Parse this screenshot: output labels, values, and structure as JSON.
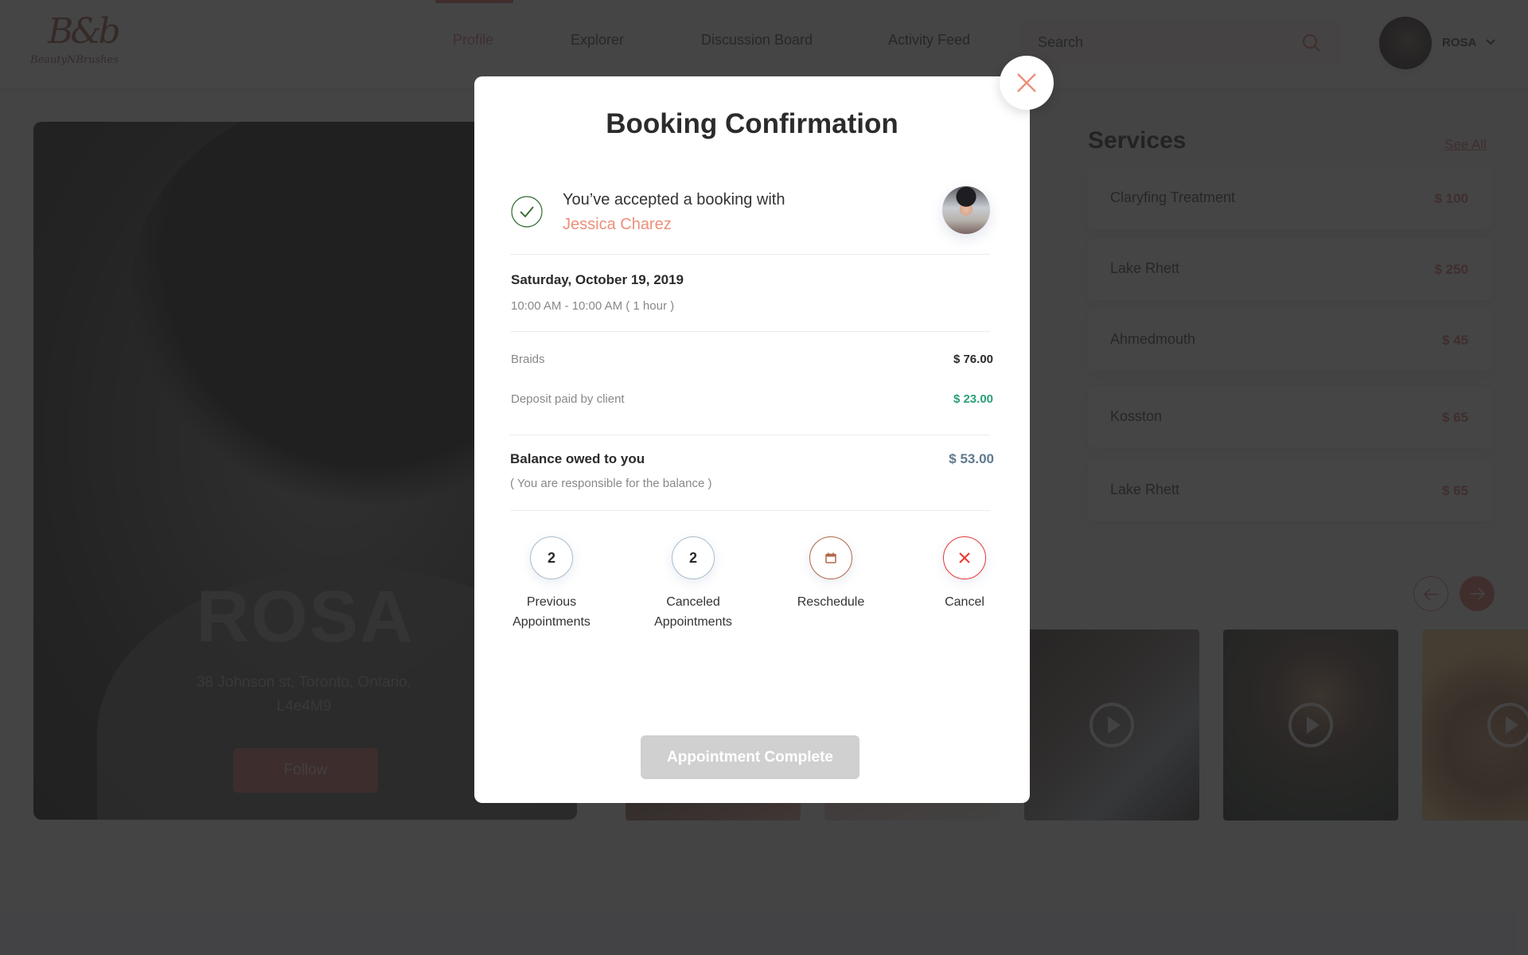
{
  "header": {
    "logo": {
      "monogram": "B&b",
      "wordmark": "BeautyNBrushes"
    },
    "nav": [
      {
        "label": "Profile",
        "active": true
      },
      {
        "label": "Explorer",
        "active": false
      },
      {
        "label": "Discussion Board",
        "active": false
      },
      {
        "label": "Activity Feed",
        "active": false
      }
    ],
    "search": {
      "placeholder": "Search",
      "value": ""
    },
    "user": {
      "name": "ROSA"
    }
  },
  "profile": {
    "name": "ROSA",
    "address": "38 Johnson st, Toronto, Ontario, L4e4M9",
    "follow_label": "Follow"
  },
  "services": {
    "title": "Services",
    "see_all_label": "See All",
    "items": [
      {
        "name": "Claryfing Treatment",
        "price": "$ 100"
      },
      {
        "name": "Lake Rhett",
        "price": "$ 250"
      },
      {
        "name": "Ahmedmouth",
        "price": "$ 45"
      },
      {
        "name": "Kosston",
        "price": "$ 65"
      },
      {
        "name": "Lake Rhett",
        "price": "$ 65"
      }
    ]
  },
  "gallery": {
    "prev_icon": "arrow-left-icon",
    "next_icon": "arrow-right-icon",
    "items": [
      {
        "type": "image"
      },
      {
        "type": "image"
      },
      {
        "type": "video"
      },
      {
        "type": "video"
      },
      {
        "type": "video"
      }
    ]
  },
  "modal": {
    "title": "Booking Confirmation",
    "accept_text": "You’ve accepted a booking with",
    "client_name": "Jessica Charez",
    "date": "Saturday, October 19, 2019",
    "time": "10:00 AM - 10:00 AM ( 1 hour )",
    "line_items": [
      {
        "label": "Braids",
        "value": "$ 76.00"
      },
      {
        "label": "Deposit paid by client",
        "value": "$ 23.00"
      }
    ],
    "balance": {
      "label": "Balance owed to you",
      "value": "$ 53.00",
      "note": "( You are responsible for the balance )"
    },
    "actions": [
      {
        "count": "2",
        "label_line1": "Previous",
        "label_line2": "Appointments"
      },
      {
        "count": "2",
        "label_line1": "Canceled",
        "label_line2": "Appointments"
      },
      {
        "icon": "calendar-icon",
        "label_line1": "Reschedule"
      },
      {
        "icon": "x-icon",
        "label_line1": "Cancel"
      }
    ],
    "complete_label": "Appointment Complete"
  },
  "colors": {
    "accent": "#d9695a",
    "client_name": "#ec8f7a",
    "deposit_green": "#2aa07a",
    "balance_blue": "#5f7a8e",
    "cancel_red": "#e53935",
    "disabled_button": "#d0d0d0"
  }
}
